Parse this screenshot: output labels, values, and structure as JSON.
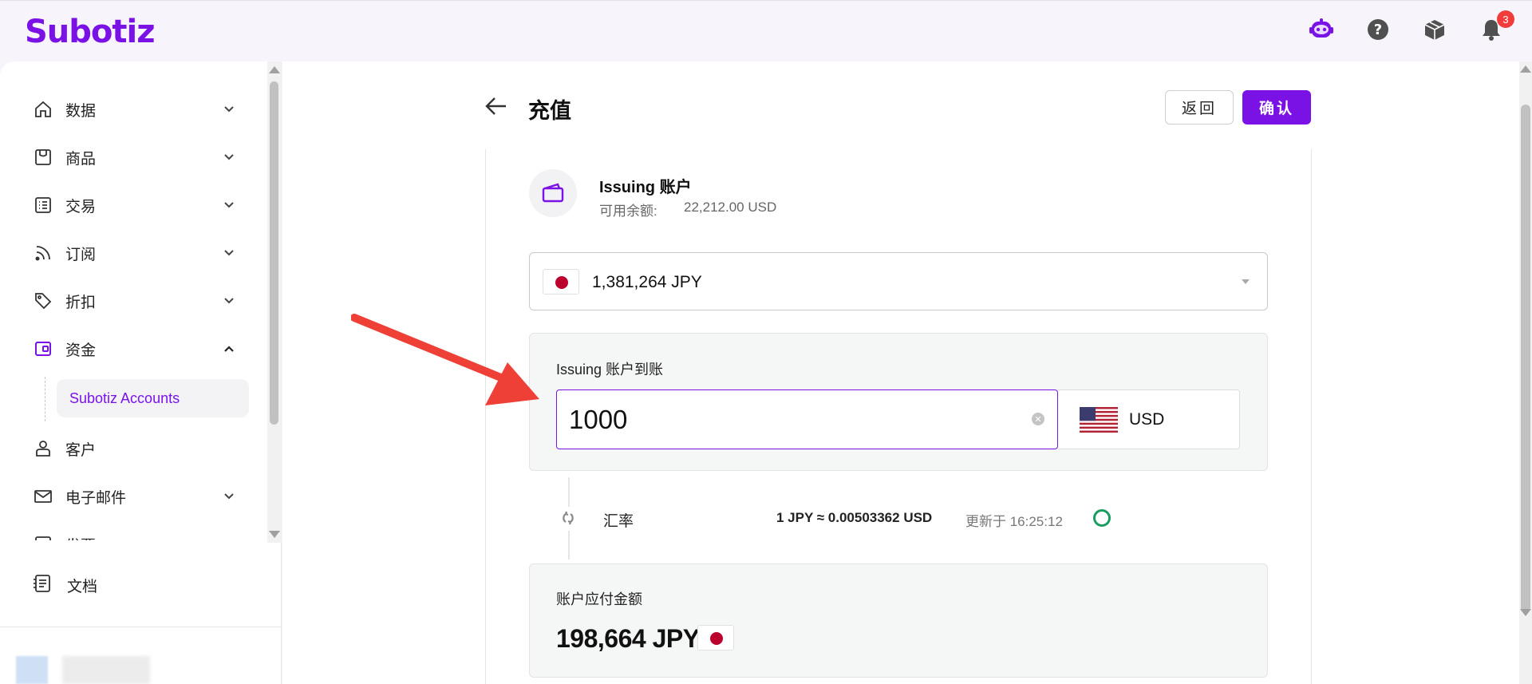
{
  "header": {
    "logo": "Subotiz",
    "notification_count": "3"
  },
  "sidebar": {
    "items": [
      {
        "label": "数据",
        "icon": "home-icon"
      },
      {
        "label": "商品",
        "icon": "store-icon"
      },
      {
        "label": "交易",
        "icon": "list-icon"
      },
      {
        "label": "订阅",
        "icon": "rss-icon"
      },
      {
        "label": "折扣",
        "icon": "tag-icon"
      },
      {
        "label": "资金",
        "icon": "wallet-icon"
      },
      {
        "label": "客户",
        "icon": "user-icon"
      },
      {
        "label": "电子邮件",
        "icon": "mail-icon"
      },
      {
        "label": "发票",
        "icon": "invoice-icon"
      }
    ],
    "sub_item": "Subotiz Accounts",
    "docs": "文档"
  },
  "page": {
    "title": "充值",
    "back_button": "返回",
    "confirm_button": "确认"
  },
  "account": {
    "name": "Issuing 账户",
    "balance_label": "可用余额:",
    "balance_value": "22,212.00 USD"
  },
  "source_select": {
    "value": "1,381,264 JPY"
  },
  "receive": {
    "label": "Issuing 账户到账",
    "amount": "1000",
    "currency": "USD"
  },
  "rate": {
    "label": "汇率",
    "value": "1 JPY ≈ 0.00503362 USD",
    "updated": "更新于 16:25:12"
  },
  "payable": {
    "label": "账户应付金额",
    "amount": "198,664 JPY"
  },
  "colors": {
    "brand": "#7a12e6",
    "success": "#1a9c60",
    "badge": "#f23b3b"
  }
}
